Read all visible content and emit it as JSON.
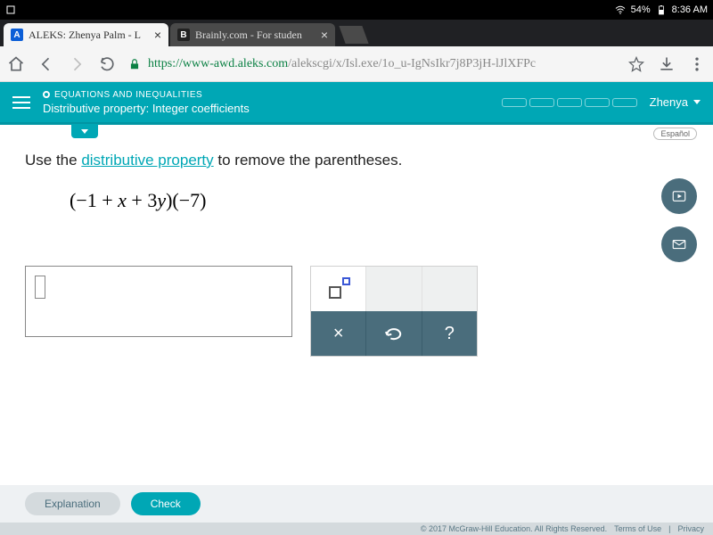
{
  "status_bar": {
    "battery": "54%",
    "time": "8:36 AM"
  },
  "browser": {
    "tabs": [
      {
        "favicon": "A",
        "title": "ALEKS: Zhenya Palm - L",
        "active": true
      },
      {
        "favicon": "B",
        "title": "Brainly.com - For studen",
        "active": false
      }
    ],
    "url_host": "https://www-awd.aleks.com",
    "url_path": "/alekscgi/x/Isl.exe/1o_u-IgNsIkr7j8P3jH-lJlXFPc"
  },
  "header": {
    "breadcrumb": "EQUATIONS AND INEQUALITIES",
    "topic": "Distributive property: Integer coefficients",
    "user": "Zhenya",
    "language_label": "Español"
  },
  "problem": {
    "instr_prefix": "Use the ",
    "instr_link": "distributive property",
    "instr_suffix": " to remove the parentheses.",
    "expression_text": "(−1 + x + 3y)(−7)"
  },
  "toolbox": {
    "labels": {
      "multiply": "×",
      "help": "?"
    }
  },
  "actions": {
    "explain": "Explanation",
    "check": "Check"
  },
  "footer": {
    "copyright": "© 2017 McGraw-Hill Education. All Rights Reserved.",
    "terms": "Terms of Use",
    "privacy": "Privacy"
  }
}
